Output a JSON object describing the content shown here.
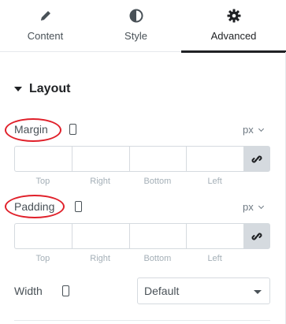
{
  "tabs": [
    {
      "label": "Content",
      "icon": "pencil-icon",
      "active": false
    },
    {
      "label": "Style",
      "icon": "half-circle-icon",
      "active": false
    },
    {
      "label": "Advanced",
      "icon": "gear-icon",
      "active": true
    }
  ],
  "section": {
    "title": "Layout",
    "expanded": true
  },
  "margin": {
    "label": "Margin",
    "unit": "px",
    "fields": [
      "",
      "",
      "",
      ""
    ],
    "sides": [
      "Top",
      "Right",
      "Bottom",
      "Left"
    ]
  },
  "padding": {
    "label": "Padding",
    "unit": "px",
    "fields": [
      "",
      "",
      "",
      ""
    ],
    "sides": [
      "Top",
      "Right",
      "Bottom",
      "Left"
    ]
  },
  "width": {
    "label": "Width",
    "value": "Default"
  },
  "colors": {
    "annotation": "#e0202a",
    "active_tab": "#1f2124",
    "text": "#495157"
  }
}
